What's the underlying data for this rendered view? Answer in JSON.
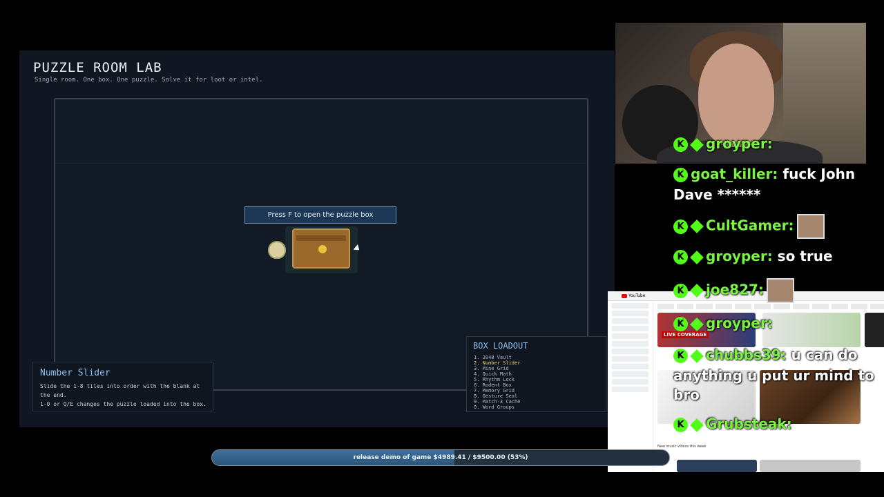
{
  "game": {
    "title": "PUZZLE ROOM LAB",
    "subtitle": "Single room. One box. One puzzle. Solve it for loot or intel.",
    "prompt": "Press F to open the puzzle box",
    "info_panel": {
      "title": "Number Slider",
      "line1": "Slide the 1-8 tiles into order with the blank at the end.",
      "line2": "1-0 or Q/E changes the puzzle loaded into the box."
    },
    "loadout": {
      "title": "BOX LOADOUT",
      "items": [
        "1. 2048 Vault",
        "2. Number Slider",
        "3. Mine Grid",
        "4. Quick Math",
        "5. Rhythm Lock",
        "6. Rodent Box",
        "7. Memory Grid",
        "8. Gesture Seal",
        "9. Match-3 Cache",
        "0. Word Groups"
      ],
      "active_index": 1
    }
  },
  "chat": {
    "messages": [
      {
        "user": "groyper:",
        "text": ""
      },
      {
        "user": "goat_killer:",
        "text": "fuck John"
      },
      {
        "user": "",
        "text": "Dave ******"
      },
      {
        "user": "CultGamer:",
        "text": ""
      },
      {
        "user": "groyper:",
        "text": "so true"
      },
      {
        "user": "joe827:",
        "text": ""
      },
      {
        "user": "groyper:",
        "text": ""
      },
      {
        "user": "chubbs39:",
        "text": "u can do"
      },
      {
        "user": "",
        "text": "anything u put ur mind to"
      },
      {
        "user": "",
        "text": "bro"
      },
      {
        "user": "Grubsteak:",
        "text": ""
      }
    ]
  },
  "youtube": {
    "logo": "YouTube",
    "live_badge": "LIVE COVERAGE",
    "caption": "New music videos this week"
  },
  "goal": {
    "text": "release demo of game $4989.41 / $9500.00 (53%)",
    "progress": 0.53
  },
  "colors": {
    "accent": "#8fc0ef",
    "kick_green": "#53fc18",
    "goal_fill": "#2c5479"
  }
}
